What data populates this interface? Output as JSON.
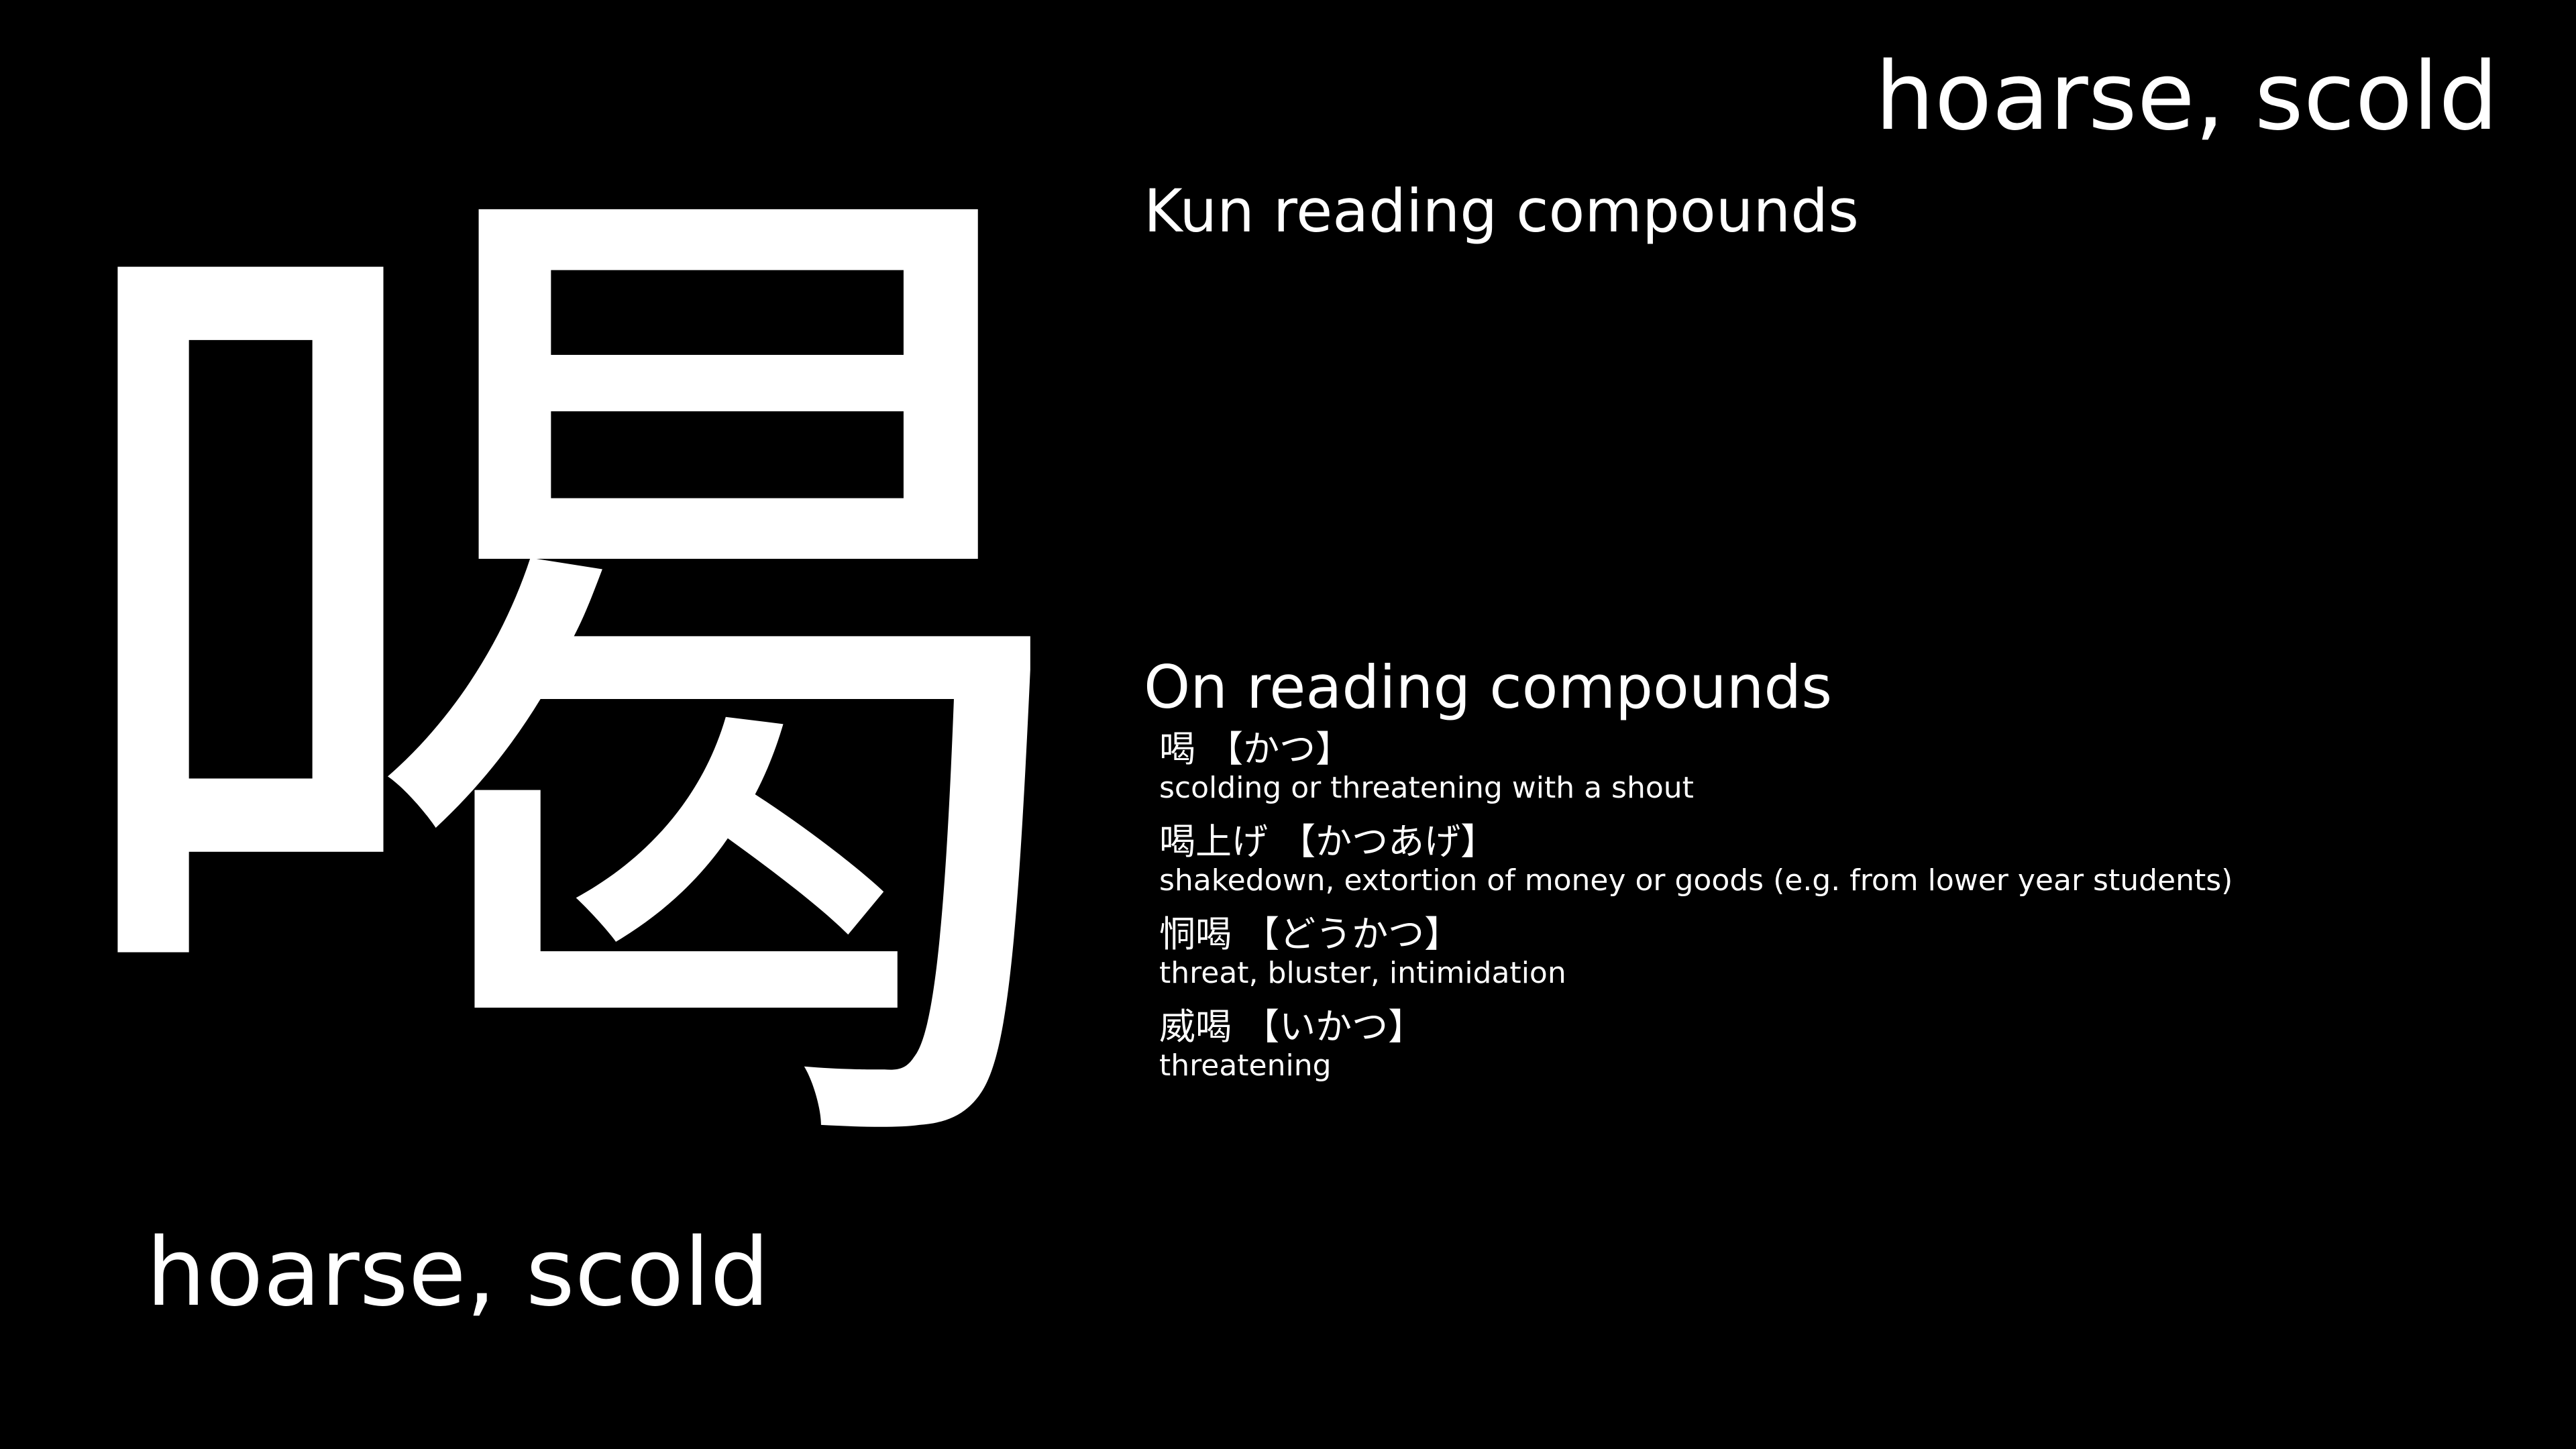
{
  "kanji": "喝",
  "meaning_top": "hoarse, scold",
  "meaning_bottom": "hoarse, scold",
  "kun_heading": "Kun reading compounds",
  "on_heading": "On reading compounds",
  "on_compounds": [
    {
      "word": "喝 【かつ】",
      "meaning": "scolding or threatening with a shout"
    },
    {
      "word": "喝上げ 【かつあげ】",
      "meaning": "shakedown, extortion of money or goods (e.g. from lower year students)"
    },
    {
      "word": "恫喝 【どうかつ】",
      "meaning": "threat, bluster, intimidation"
    },
    {
      "word": "威喝 【いかつ】",
      "meaning": "threatening"
    }
  ]
}
